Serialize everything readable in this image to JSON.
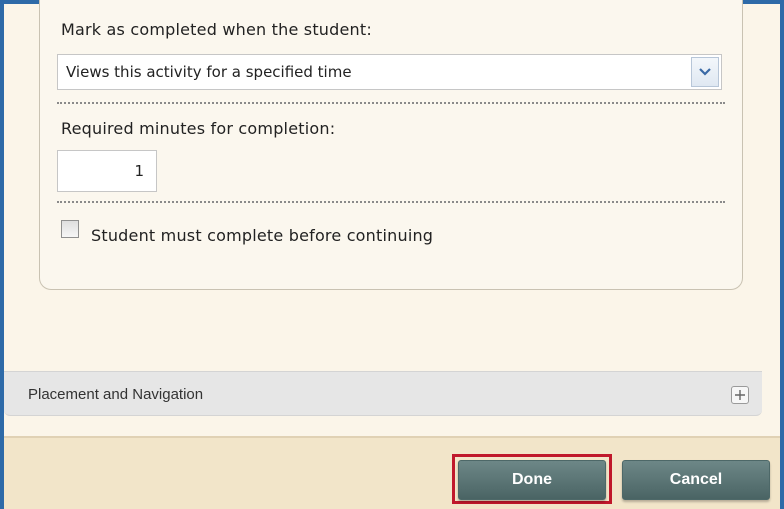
{
  "completion": {
    "mark_label": "Mark as completed when the student:",
    "select_value": "Views this activity for a specified time",
    "minutes_label": "Required minutes for completion:",
    "minutes_value": "1",
    "checkbox_label": "Student must complete before continuing",
    "checkbox_checked": false
  },
  "placement": {
    "label": "Placement and Navigation",
    "expand_icon": "plus-icon"
  },
  "footer": {
    "done_label": "Done",
    "cancel_label": "Cancel"
  },
  "colors": {
    "window_border": "#2e6aa8",
    "panel_bg": "#fbf5e9",
    "footer_bg": "#f2e5c9",
    "button_bg": "#5b7676",
    "highlight": "#c0182b"
  }
}
